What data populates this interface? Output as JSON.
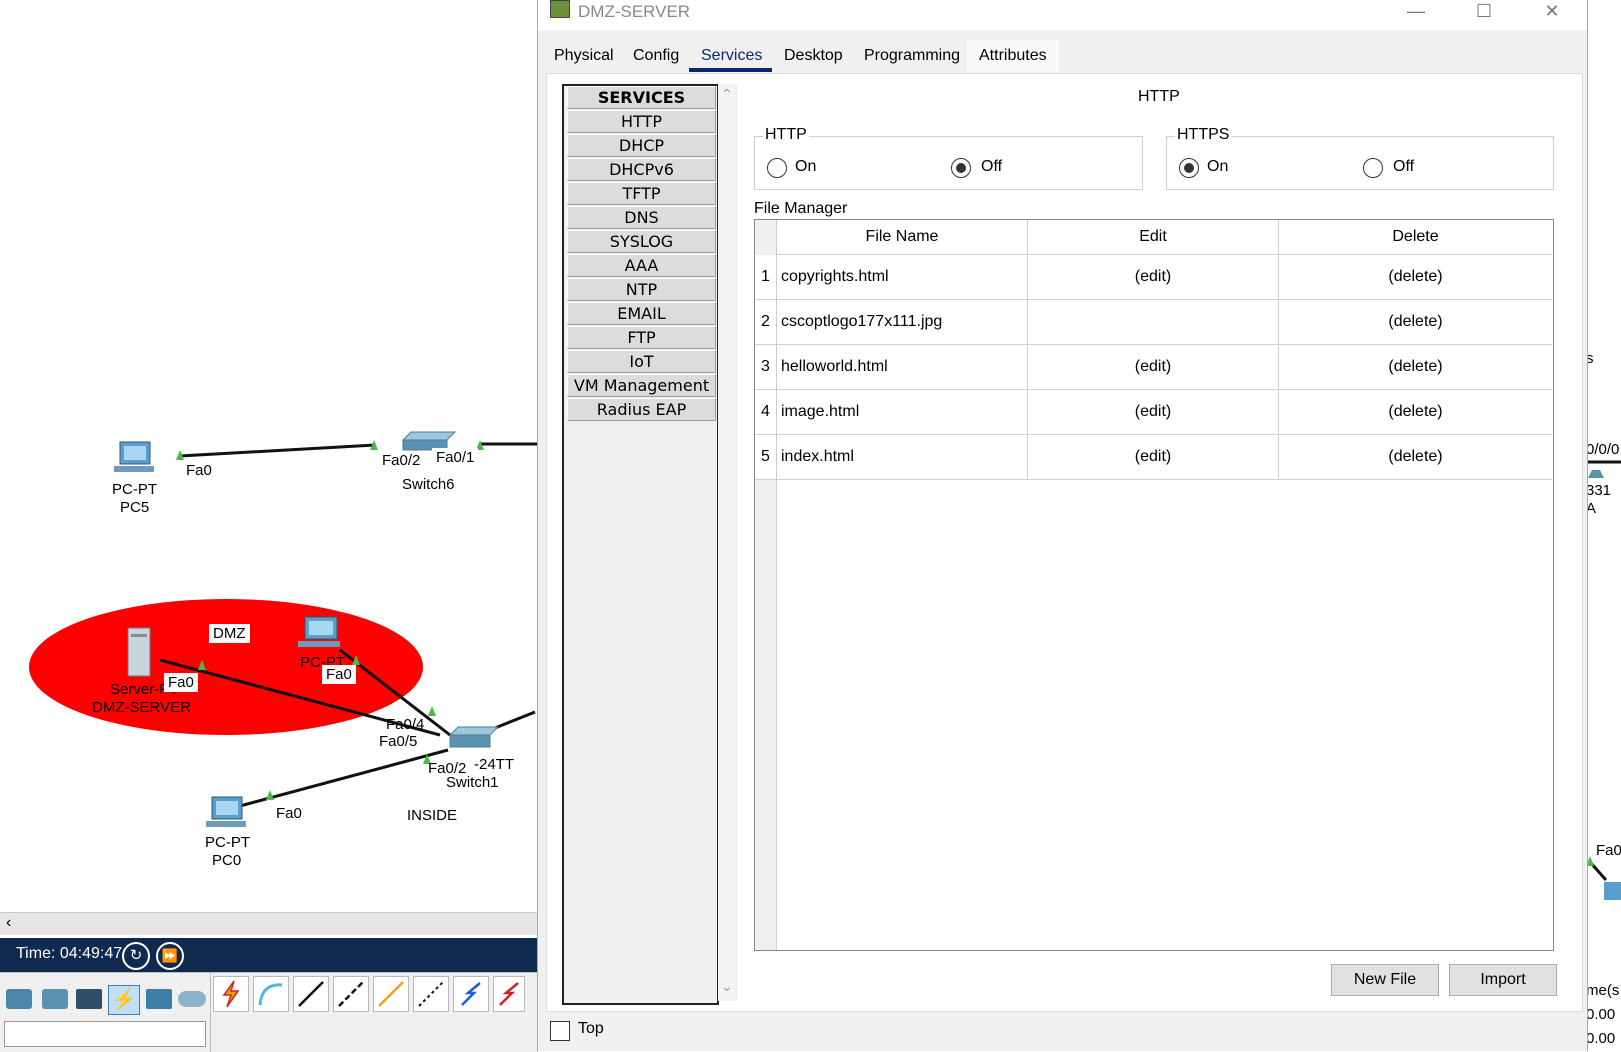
{
  "window": {
    "title": "DMZ-SERVER",
    "tabs": [
      "Physical",
      "Config",
      "Services",
      "Desktop",
      "Programming",
      "Attributes"
    ],
    "active_tab": "Services"
  },
  "services": {
    "header": "SERVICES",
    "items": [
      "HTTP",
      "DHCP",
      "DHCPv6",
      "TFTP",
      "DNS",
      "SYSLOG",
      "AAA",
      "NTP",
      "EMAIL",
      "FTP",
      "IoT",
      "VM Management",
      "Radius EAP"
    ]
  },
  "http_panel": {
    "title": "HTTP",
    "http_group": {
      "label": "HTTP",
      "on_label": "On",
      "off_label": "Off",
      "selected": "Off"
    },
    "https_group": {
      "label": "HTTPS",
      "on_label": "On",
      "off_label": "Off",
      "selected": "On"
    },
    "file_manager": {
      "label": "File Manager",
      "columns": [
        "File Name",
        "Edit",
        "Delete"
      ],
      "rows": [
        {
          "num": "1",
          "name": "copyrights.html",
          "edit": "(edit)",
          "delete": "(delete)"
        },
        {
          "num": "2",
          "name": "cscoptlogo177x111.jpg",
          "edit": "",
          "delete": "(delete)"
        },
        {
          "num": "3",
          "name": "helloworld.html",
          "edit": "(edit)",
          "delete": "(delete)"
        },
        {
          "num": "4",
          "name": "image.html",
          "edit": "(edit)",
          "delete": "(delete)"
        },
        {
          "num": "5",
          "name": "index.html",
          "edit": "(edit)",
          "delete": "(delete)"
        }
      ]
    },
    "new_file_button": "New File",
    "import_button": "Import"
  },
  "top_checkbox": "Top",
  "workspace": {
    "time_label": "Time: 04:49:47",
    "devices": {
      "pc5_type": "PC-PT",
      "pc5_name": "PC5",
      "switch6_name": "Switch6",
      "server_type": "Server-PT",
      "server_name": "DMZ-SERVER",
      "pc_dmz_type": "PC-PT",
      "switch1_model": "-24TT",
      "switch1_name": "Switch1",
      "pc0_type": "PC-PT",
      "pc0_name": "PC0"
    },
    "ports": {
      "pc5_fa0": "Fa0",
      "sw6_fa02": "Fa0/2",
      "sw6_fa01": "Fa0/1",
      "server_fa0": "Fa0",
      "pc_dmz_fa0": "Fa0",
      "sw1_fa04": "Fa0/4",
      "sw1_fa05": "Fa0/5",
      "sw1_fa02": "Fa0/2",
      "pc0_fa0": "Fa0"
    },
    "zone_labels": {
      "dmz": "DMZ",
      "inside": "INSIDE"
    },
    "right_edge_fragments": [
      "s",
      "0/0/0",
      "331",
      "A",
      "Fa0",
      "me(s",
      "0.00",
      "0.00"
    ]
  },
  "colors": {
    "dmz_zone": "#ff0000",
    "time_bar": "#102a4f",
    "active_tab": "#0a2a6e"
  }
}
